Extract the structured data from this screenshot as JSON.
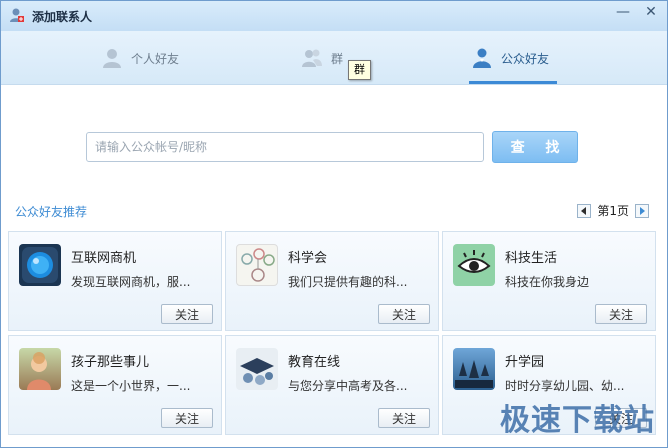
{
  "window": {
    "title": "添加联系人"
  },
  "tabs": [
    {
      "label": "个人好友",
      "icon": "person-icon"
    },
    {
      "label": "群",
      "icon": "group-icon"
    },
    {
      "label": "公众好友",
      "icon": "public-account-icon"
    }
  ],
  "tooltip": "群",
  "search": {
    "placeholder": "请输入公众帐号/昵称",
    "button_label": "查 找"
  },
  "recommend": {
    "title": "公众好友推荐",
    "page_label": "第1页"
  },
  "cards": [
    {
      "name": "互联网商机",
      "desc": "发现互联网商机，服...",
      "follow_label": "关注"
    },
    {
      "name": "科学会",
      "desc": "我们只提供有趣的科...",
      "follow_label": "关注"
    },
    {
      "name": "科技生活",
      "desc": "科技在你我身边",
      "follow_label": "关注"
    },
    {
      "name": "孩子那些事儿",
      "desc": "这是一个小世界，一...",
      "follow_label": "关注"
    },
    {
      "name": "教育在线",
      "desc": "与您分享中高考及各...",
      "follow_label": "关注"
    },
    {
      "name": "升学园",
      "desc": "时时分享幼儿园、幼...",
      "follow_label": "关注"
    }
  ],
  "watermark": "极速下载站",
  "colors": {
    "accent": "#3c8ad6",
    "search_button": "#7dbdf2",
    "link": "#3d8bd3"
  }
}
